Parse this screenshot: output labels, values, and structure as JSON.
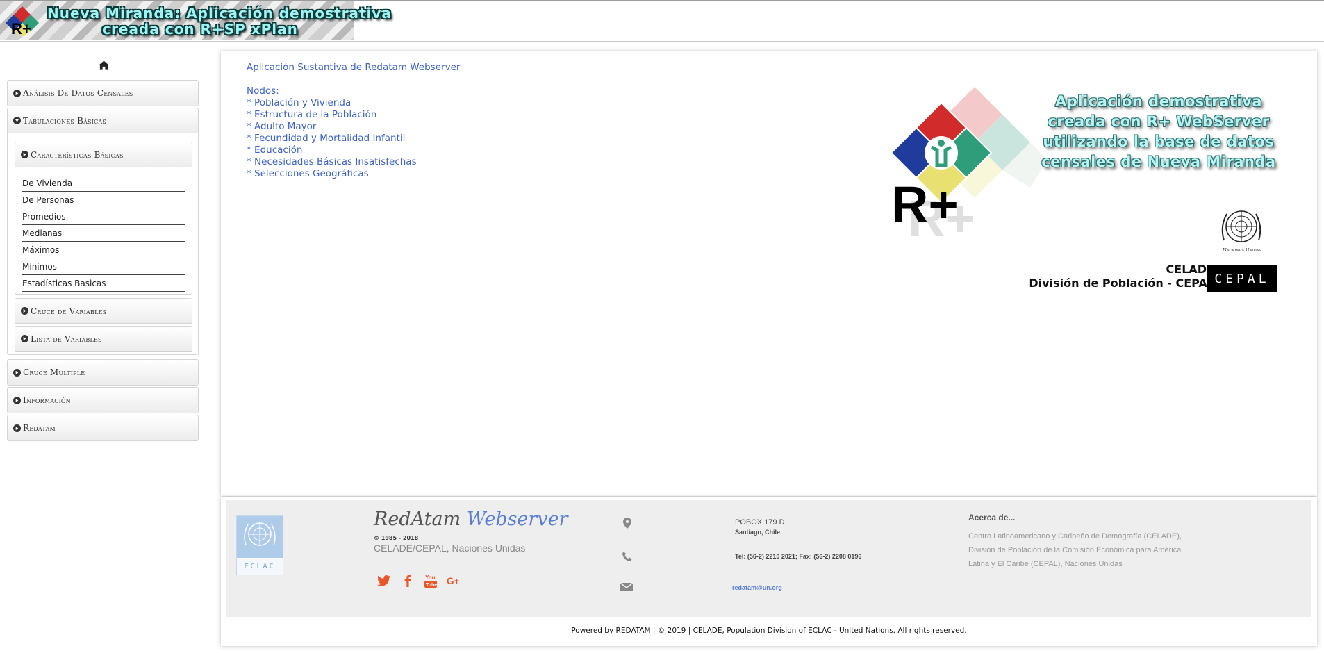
{
  "header": {
    "title_line1": "Nueva Miranda: Aplicación demostrativa",
    "title_line2": "creada con R+SP xPlan"
  },
  "sidebar": {
    "home_icon": "home-icon",
    "sections": [
      {
        "label": "Análisis De Datos Censales",
        "state": "collapsed"
      },
      {
        "label": "Tabulaciones Básicas",
        "state": "expanded"
      },
      {
        "label": "Cruce Múltiple",
        "state": "collapsed"
      },
      {
        "label": "Información",
        "state": "collapsed"
      },
      {
        "label": "Redatam",
        "state": "collapsed"
      }
    ],
    "subsections": [
      {
        "label": "Características Básicas",
        "state": "expanded"
      },
      {
        "label": "Cruce de Variables",
        "state": "collapsed"
      },
      {
        "label": "Lista de Variables",
        "state": "collapsed"
      }
    ],
    "links": [
      "De Vivienda",
      "De Personas",
      "Promedios",
      "Medianas",
      "Máximos",
      "Mínimos",
      "Estadísticas Basicas"
    ]
  },
  "main": {
    "title": "Aplicación Sustantiva de Redatam Webserver",
    "nodes_label": "Nodos:",
    "nodes": [
      "* Población y Vivienda",
      "* Estructura de la Población",
      "* Adulto Mayor",
      "* Fecundidad y Mortalidad Infantil",
      "* Educación",
      "* Necesidades Básicas Insatisfechas",
      "* Selecciones Geográficas"
    ],
    "promo_lines": [
      "Aplicación demostrativa",
      "creada con R+ WebServer",
      "utilizando la base de datos",
      "censales de Nueva Miranda"
    ],
    "un_emblem_text": "Naciones Unidas",
    "celade_line1": "CELADE",
    "celade_line2": "División de Población - CEPAL",
    "cepal_logo_text": "CEPAL"
  },
  "footer": {
    "un_logo_band": "ECLAC",
    "brand_part1": "RedAtam",
    "brand_part2": "Webserver",
    "copyright": "© 1985 - 2018",
    "org": "CELADE/CEPAL, Naciones Unidas",
    "social": [
      "twitter-icon",
      "facebook-icon",
      "youtube-icon",
      "google-plus-icon"
    ],
    "address_line1": "POBOX 179 D",
    "address_line2": "Santiago, Chile",
    "phone": "Tel: (56-2) 2210 2021; Fax: (56-2) 2208 0196",
    "email": "redatam@un.org",
    "about_title": "Acerca de...",
    "about_text": "Centro Latinoamericano y Caribeño de Demografía (CELADE), División de Población de la Comisión Económica para América Latina y El Caribe (CEPAL), Naciones Unidas",
    "powered_prefix": "Powered by",
    "powered_link": "REDATAM",
    "powered_suffix": "| © 2019 | CELADE, Population Division of ECLAC - United Nations. All rights reserved."
  },
  "colors": {
    "link_blue": "#3d63c4",
    "accent_orange": "#e8572a",
    "brand_blue": "#5a7fd4"
  }
}
